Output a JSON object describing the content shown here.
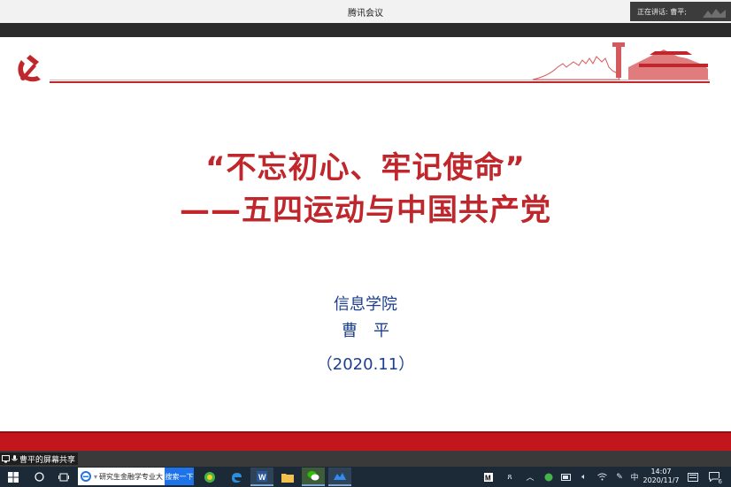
{
  "window": {
    "title": "腾讯会议",
    "speaking_label": "正在讲话: 曹平;"
  },
  "slide": {
    "heading_line1": "“不忘初心、牢记使命”",
    "heading_line2": "——五四运动与中国共产党",
    "college": "信息学院",
    "name": "曹　平",
    "date": "（2020.11）"
  },
  "share": {
    "label": "曹平的屏幕共享"
  },
  "taskbar": {
    "search_text": "研究生金融学专业大",
    "search_button": "搜索一下",
    "ime_label": "中",
    "time": "14:07",
    "date": "2020/11/7",
    "notification_count": "6"
  },
  "colors": {
    "accent_red": "#c0272d",
    "text_blue": "#1b3f8f",
    "taskbar": "#1c2a38"
  }
}
